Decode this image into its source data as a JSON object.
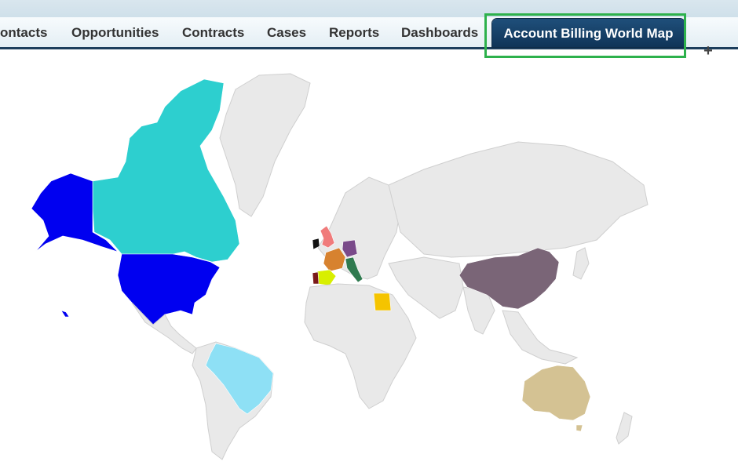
{
  "tabs": [
    {
      "label": "ontacts"
    },
    {
      "label": "Opportunities"
    },
    {
      "label": "Contracts"
    },
    {
      "label": "Cases"
    },
    {
      "label": "Reports"
    },
    {
      "label": "Dashboards"
    }
  ],
  "active_tab": {
    "label": "Account Billing World Map"
  },
  "add_tab": {
    "label": "+"
  },
  "colors": {
    "land": "#e9e9e9",
    "canada": "#2dcfcf",
    "usa": "#0000f0",
    "brazil": "#8ee0f5",
    "china": "#7a6577",
    "australia": "#d4c293",
    "uk": "#f07b7b",
    "ireland": "#111111",
    "france": "#d7822f",
    "germany": "#7a4a8a",
    "italy": "#2f7a4f",
    "spain": "#d8ef00",
    "portugal": "#7a1a1a",
    "egypt": "#f5c400",
    "highlight": "#2db14c"
  }
}
